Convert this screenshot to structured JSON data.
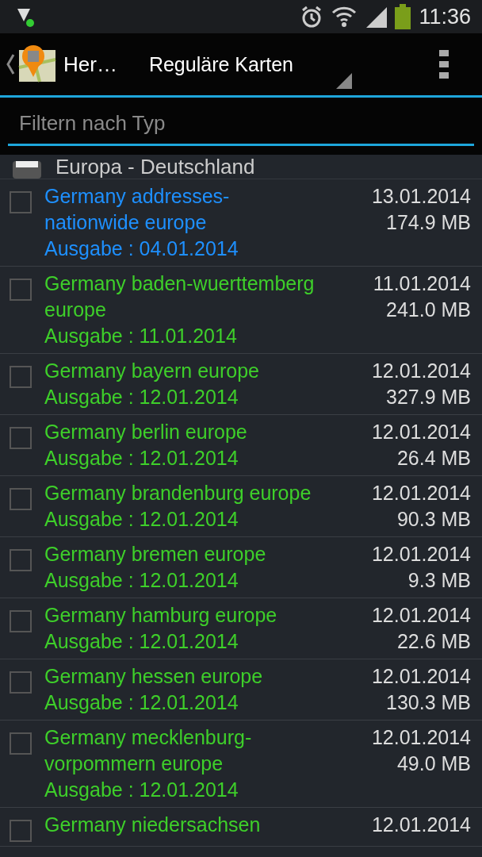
{
  "status_bar": {
    "time": "11:36"
  },
  "app_bar": {
    "title": "Her…",
    "spinner": "Reguläre Karten"
  },
  "filter": {
    "placeholder": "Filtern nach Typ"
  },
  "group": {
    "title": "Europa - Deutschland"
  },
  "rows": [
    {
      "name": "Germany addresses-nationwide europe",
      "edition": "Ausgabe : 04.01.2014",
      "date": "13.01.2014",
      "size": "174.9 MB",
      "checked": false,
      "color": "#1e90ff"
    },
    {
      "name": "Germany baden-wuerttemberg europe",
      "edition": "Ausgabe : 11.01.2014",
      "date": "11.01.2014",
      "size": "241.0 MB",
      "checked": false,
      "color": "#3ecf2a"
    },
    {
      "name": "Germany bayern europe",
      "edition": "Ausgabe : 12.01.2014",
      "date": "12.01.2014",
      "size": "327.9 MB",
      "checked": false,
      "color": "#3ecf2a"
    },
    {
      "name": "Germany berlin europe",
      "edition": "Ausgabe : 12.01.2014",
      "date": "12.01.2014",
      "size": "26.4 MB",
      "checked": false,
      "color": "#3ecf2a"
    },
    {
      "name": "Germany brandenburg europe",
      "edition": "Ausgabe : 12.01.2014",
      "date": "12.01.2014",
      "size": "90.3 MB",
      "checked": false,
      "color": "#3ecf2a"
    },
    {
      "name": "Germany bremen europe",
      "edition": "Ausgabe : 12.01.2014",
      "date": "12.01.2014",
      "size": "9.3 MB",
      "checked": false,
      "color": "#3ecf2a"
    },
    {
      "name": "Germany hamburg europe",
      "edition": "Ausgabe : 12.01.2014",
      "date": "12.01.2014",
      "size": "22.6 MB",
      "checked": false,
      "color": "#3ecf2a"
    },
    {
      "name": "Germany hessen europe",
      "edition": "Ausgabe : 12.01.2014",
      "date": "12.01.2014",
      "size": "130.3 MB",
      "checked": false,
      "color": "#3ecf2a"
    },
    {
      "name": "Germany mecklenburg-vorpommern europe",
      "edition": "Ausgabe : 12.01.2014",
      "date": "12.01.2014",
      "size": "49.0 MB",
      "checked": false,
      "color": "#3ecf2a"
    },
    {
      "name": "Germany niedersachsen",
      "date": "12.01.2014",
      "checked": false,
      "color": "#3ecf2a"
    }
  ]
}
